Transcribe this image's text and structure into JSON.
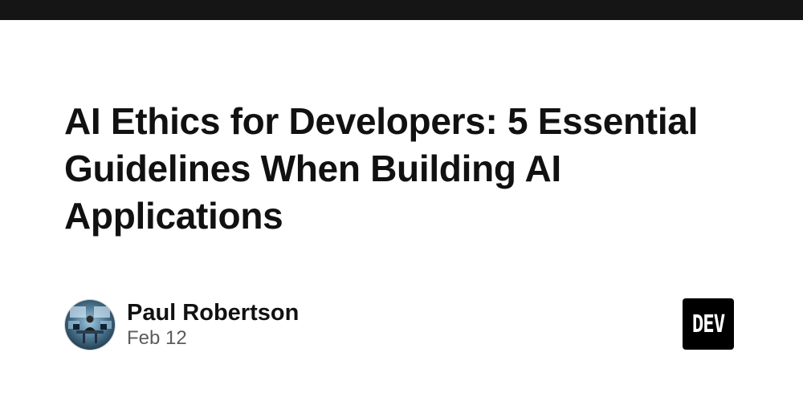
{
  "post": {
    "title": "AI Ethics for Developers: 5 Essential Guidelines When Building AI Applications"
  },
  "author": {
    "name": "Paul Robertson",
    "date": "Feb 12",
    "avatar_icon": "avatar-person-at-desk"
  },
  "brand": {
    "logo_text": "DEV",
    "logo_bg": "#000000",
    "top_bar_color": "#151515"
  }
}
